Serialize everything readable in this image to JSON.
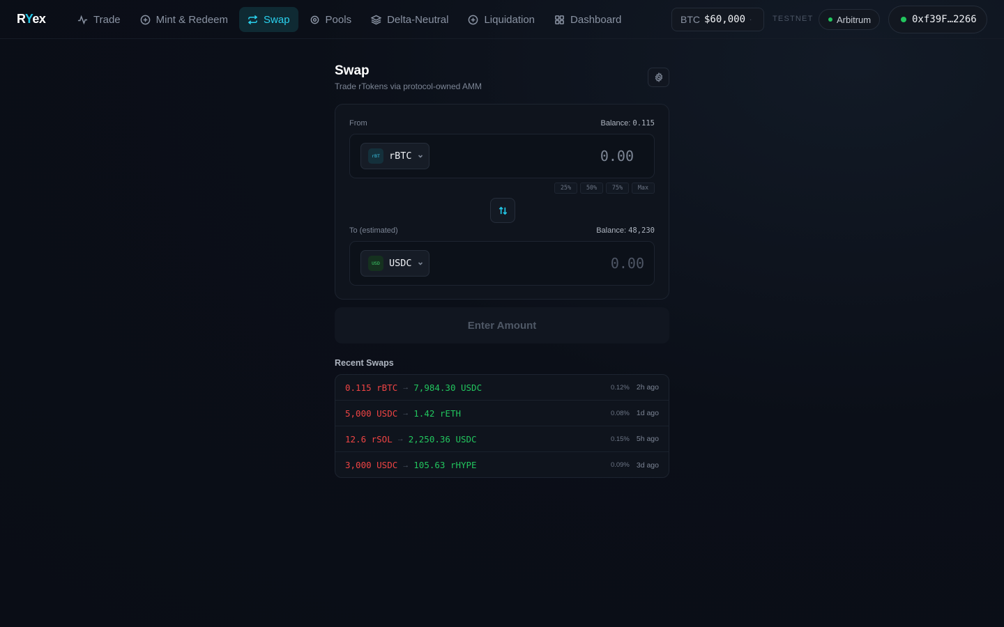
{
  "brand": {
    "logo_prefix": "R",
    "logo_accent": "Y",
    "logo_suffix": "ex"
  },
  "nav": {
    "items": [
      {
        "label": "Trade",
        "icon": "activity-icon",
        "active": false
      },
      {
        "label": "Mint & Redeem",
        "icon": "plus-circle-icon",
        "active": false
      },
      {
        "label": "Swap",
        "icon": "repeat-icon",
        "active": true
      },
      {
        "label": "Pools",
        "icon": "target-icon",
        "active": false
      },
      {
        "label": "Delta-Neutral",
        "icon": "layers-icon",
        "active": false
      },
      {
        "label": "Liquidation",
        "icon": "plus-circle-icon",
        "active": false
      },
      {
        "label": "Dashboard",
        "icon": "grid-icon",
        "active": false
      }
    ]
  },
  "header": {
    "btc_label": "BTC",
    "btc_price": "$60,000",
    "btc_dot": "·",
    "network_mode": "TESTNET",
    "network": "Arbitrum",
    "wallet": "0xf39F…2266",
    "accent_color": "#22c6e6",
    "status_color": "#22c55e"
  },
  "swap": {
    "title": "Swap",
    "subtitle": "Trade rTokens via protocol-owned AMM",
    "from": {
      "label": "From",
      "balance_label": "Balance:",
      "balance_value": "0.115",
      "token": "rBTC",
      "token_badge": "rBT",
      "amount": "0.00"
    },
    "percent_buttons": [
      "25%",
      "50%",
      "75%",
      "Max"
    ],
    "to": {
      "label": "To (estimated)",
      "balance_label": "Balance:",
      "balance_value": "48,230",
      "token": "USDC",
      "token_badge": "USD",
      "amount": "0.00"
    },
    "submit_label": "Enter Amount"
  },
  "recent": {
    "title": "Recent Swaps",
    "rows": [
      {
        "from": "0.115 rBTC",
        "arrow": "→",
        "to": "7,984.30 USDC",
        "fee": "0.12%",
        "time": "2h ago"
      },
      {
        "from": "5,000 USDC",
        "arrow": "→",
        "to": "1.42 rETH",
        "fee": "0.08%",
        "time": "1d ago"
      },
      {
        "from": "12.6 rSOL",
        "arrow": "→",
        "to": "2,250.36 USDC",
        "fee": "0.15%",
        "time": "5h ago"
      },
      {
        "from": "3,000 USDC",
        "arrow": "→",
        "to": "105.63 rHYPE",
        "fee": "0.09%",
        "time": "3d ago"
      }
    ]
  }
}
